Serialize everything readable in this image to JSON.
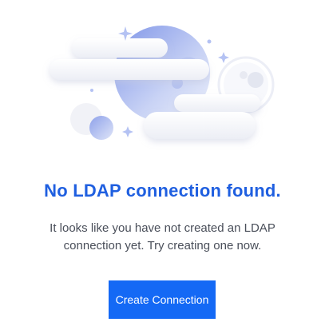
{
  "empty_state": {
    "illustration_icon": "moon-clouds-illustration",
    "title": "No LDAP connection found.",
    "description": "It looks like you have not created an LDAP connection yet. Try creating one now.",
    "create_button_label": "Create Connection"
  },
  "colors": {
    "title": "#1f5fe0",
    "button_background": "#1469f5",
    "button_text": "#ffffff",
    "description_text": "#4a4f5a"
  }
}
